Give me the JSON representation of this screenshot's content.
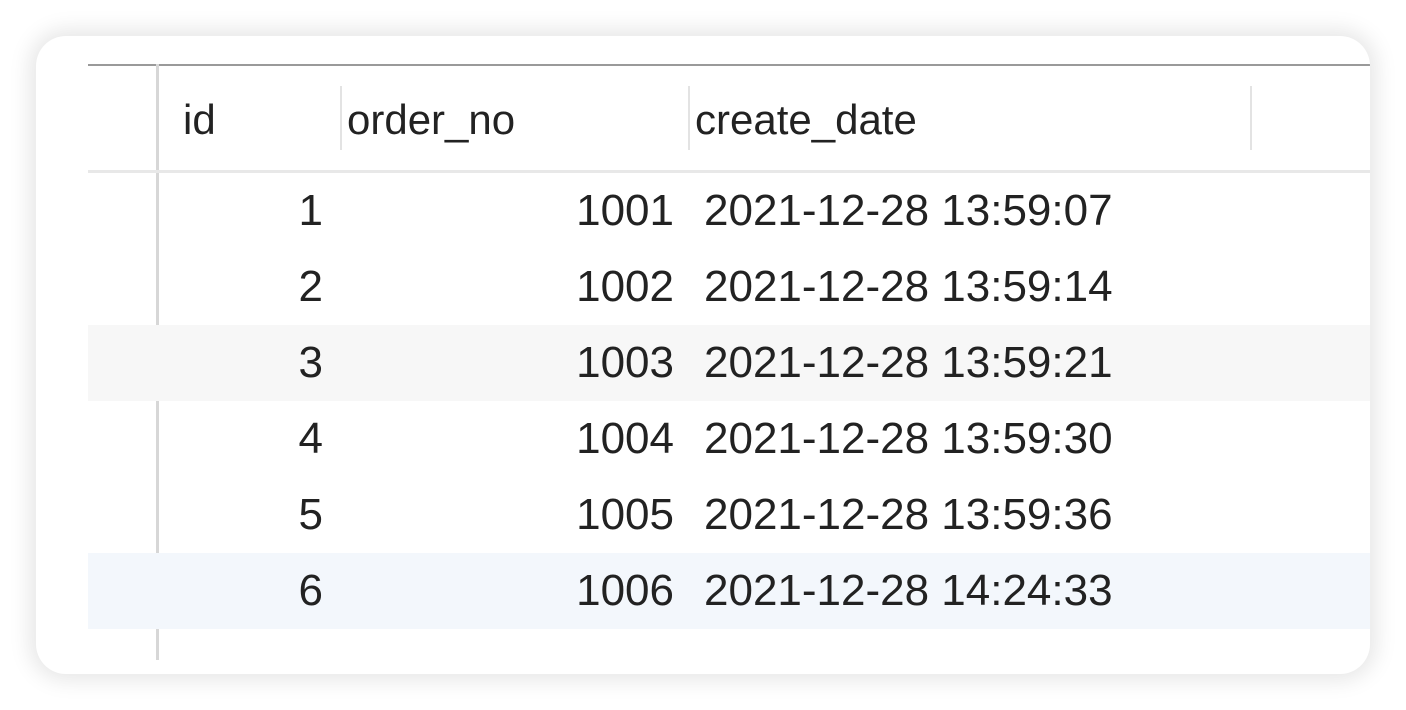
{
  "table": {
    "columns": [
      "id",
      "order_no",
      "create_date"
    ],
    "rows": [
      {
        "id": "1",
        "order_no": "1001",
        "create_date": "2021-12-28 13:59:07"
      },
      {
        "id": "2",
        "order_no": "1002",
        "create_date": "2021-12-28 13:59:14"
      },
      {
        "id": "3",
        "order_no": "1003",
        "create_date": "2021-12-28 13:59:21"
      },
      {
        "id": "4",
        "order_no": "1004",
        "create_date": "2021-12-28 13:59:30"
      },
      {
        "id": "5",
        "order_no": "1005",
        "create_date": "2021-12-28 13:59:36"
      },
      {
        "id": "6",
        "order_no": "1006",
        "create_date": "2021-12-28 14:24:33"
      }
    ],
    "selected_row": 6
  },
  "colors": {
    "alt_row": "#f7f7f7",
    "selected_row": "#f3f7fc",
    "text": "#222222"
  }
}
